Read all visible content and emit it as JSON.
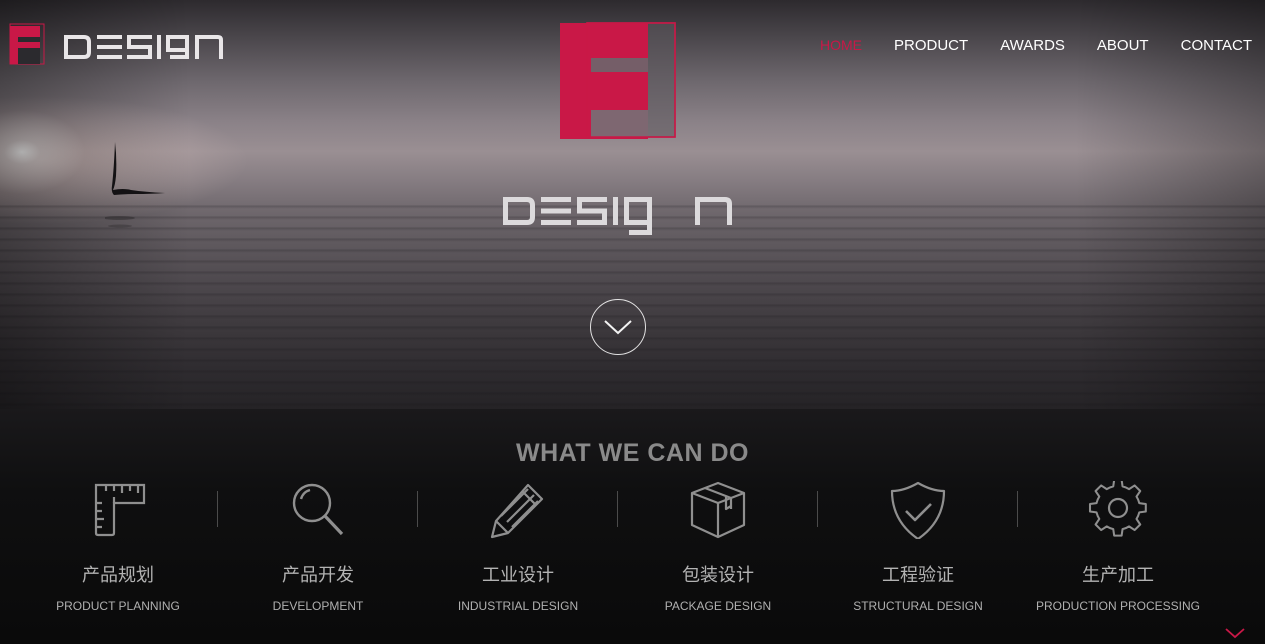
{
  "header": {
    "logo_text": "DESIGN"
  },
  "nav": {
    "items": [
      {
        "label": "HOME",
        "active": true
      },
      {
        "label": "PRODUCT",
        "active": false
      },
      {
        "label": "AWARDS",
        "active": false
      },
      {
        "label": "ABOUT",
        "active": false
      },
      {
        "label": "CONTACT",
        "active": false
      }
    ]
  },
  "hero": {
    "mark_letter": "F",
    "wordmark": "DESIGN",
    "scroll_icon": "chevron-down-icon"
  },
  "services": {
    "title": "WHAT WE CAN DO",
    "items": [
      {
        "cn": "产品规划",
        "en": "PRODUCT PLANNING",
        "icon": "ruler-icon"
      },
      {
        "cn": "产品开发",
        "en": "DEVELOPMENT",
        "icon": "magnifier-icon"
      },
      {
        "cn": "工业设计",
        "en": "INDUSTRIAL DESIGN",
        "icon": "pencil-icon"
      },
      {
        "cn": "包装设计",
        "en": "PACKAGE DESIGN",
        "icon": "box-icon"
      },
      {
        "cn": "工程验证",
        "en": "STRUCTURAL DESIGN",
        "icon": "shield-check-icon"
      },
      {
        "cn": "生产加工",
        "en": "PRODUCTION PROCESSING",
        "icon": "gear-icon"
      }
    ]
  },
  "colors": {
    "accent": "#c91847",
    "nav_text": "#ffffff",
    "section_title": "#8a8a8a",
    "service_text": "#b3b3b3"
  }
}
